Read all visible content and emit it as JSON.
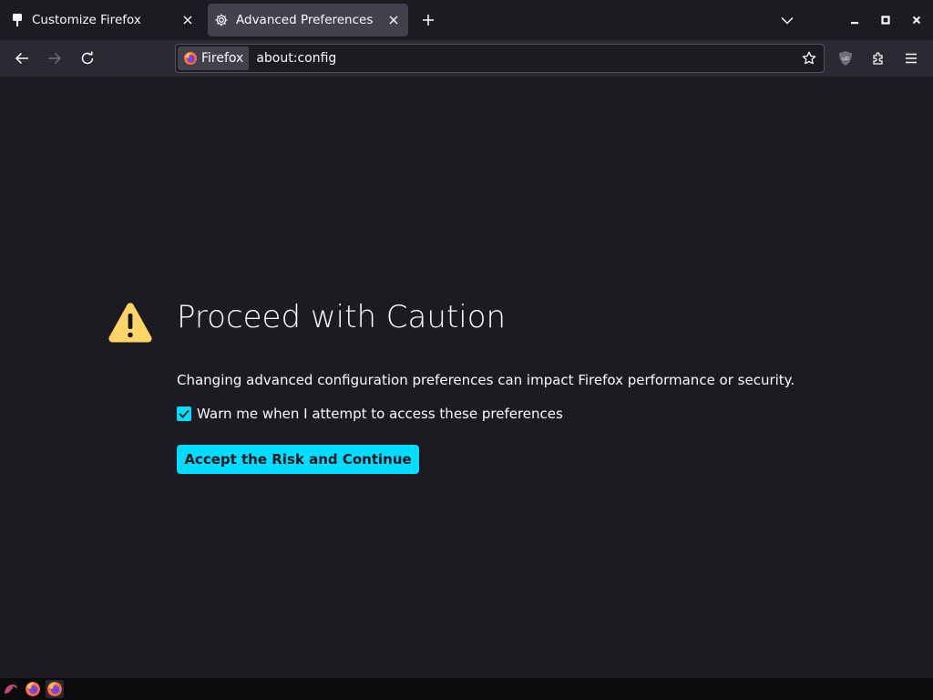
{
  "tabs": [
    {
      "label": "Customize Firefox",
      "icon": "paintbrush-icon",
      "active": false
    },
    {
      "label": "Advanced Preferences",
      "icon": "gear-icon",
      "active": true
    }
  ],
  "toolbar": {
    "identity_label": "Firefox",
    "url": "about:config"
  },
  "page": {
    "title": "Proceed with Caution",
    "description": "Changing advanced configuration preferences can impact Firefox performance or security.",
    "warn_checkbox_label": "Warn me when I attempt to access these preferences",
    "warn_checkbox_checked": true,
    "accept_button_label": "Accept the Risk and Continue"
  },
  "colors": {
    "accent": "#00ddff",
    "warning": "#ffd567",
    "background": "#1c1b22",
    "toolbar": "#2b2a33"
  },
  "taskbar": {
    "icons": [
      "kde-launcher-icon",
      "firefox-icon",
      "firefox-icon"
    ]
  }
}
